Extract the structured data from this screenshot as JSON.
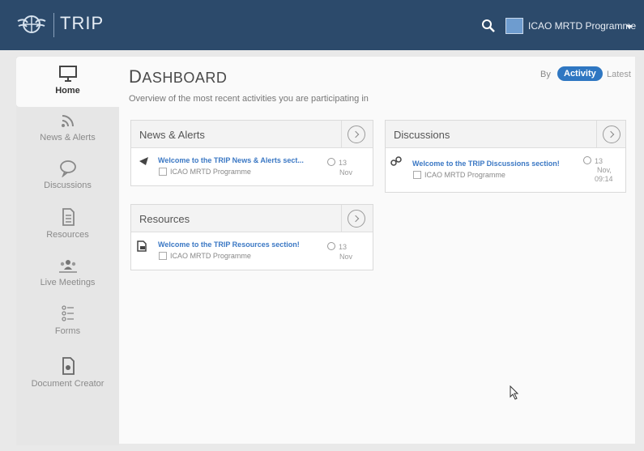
{
  "header": {
    "app_name": "TRIP",
    "user_name": "ICAO MRTD Programme",
    "brand_color": "#2c4a6b",
    "icons": [
      "icao-logo-icon",
      "search-icon",
      "user-avatar",
      "caret-down-icon"
    ]
  },
  "sidebar": {
    "items": [
      {
        "label": "Home",
        "icon": "monitor-icon",
        "active": true
      },
      {
        "label": "News & Alerts",
        "icon": "rss-icon",
        "active": false
      },
      {
        "label": "Discussions",
        "icon": "speech-bubble-icon",
        "active": false
      },
      {
        "label": "Resources",
        "icon": "document-icon",
        "active": false
      },
      {
        "label": "Live Meetings",
        "icon": "people-icon",
        "active": false
      },
      {
        "label": "Forms",
        "icon": "form-list-icon",
        "active": false
      },
      {
        "label": "Document Creator",
        "icon": "document-creator-icon",
        "active": false
      }
    ]
  },
  "dashboard": {
    "title_first": "D",
    "title_rest": "ASHBOARD",
    "subtitle": "Overview of the most recent activities you are participating in",
    "sort": {
      "by_label": "By",
      "active": "Activity",
      "other": "Latest"
    }
  },
  "panels": {
    "news": {
      "title": "News & Alerts",
      "item": {
        "link": "Welcome to the TRIP News & Alerts sect...",
        "group": "ICAO MRTD Programme",
        "date_day": "13",
        "date_rest": "Nov"
      }
    },
    "discussions": {
      "title": "Discussions",
      "item": {
        "link": "Welcome to the TRIP Discussions section!",
        "group": "ICAO MRTD Programme",
        "date_day": "13",
        "date_rest": "Nov,",
        "date_time": "09:14"
      }
    },
    "resources": {
      "title": "Resources",
      "item": {
        "link": "Welcome to the TRIP Resources section!",
        "group": "ICAO MRTD Programme",
        "date_day": "13",
        "date_rest": "Nov"
      }
    }
  },
  "colors": {
    "accent": "#2f77c2",
    "link": "#3b78c4"
  }
}
